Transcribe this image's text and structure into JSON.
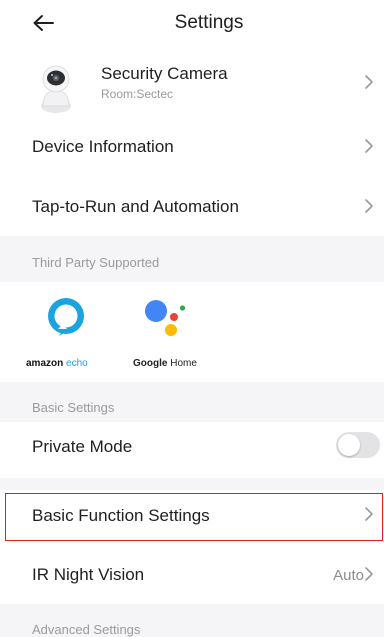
{
  "header": {
    "title": "Settings",
    "back_icon": "arrow-left-icon"
  },
  "device": {
    "name": "Security Camera",
    "room": "Room:Sectec",
    "icon": "camera-icon"
  },
  "rows": {
    "device_info": "Device Information",
    "tap_to_run": "Tap-to-Run and Automation",
    "private_mode": "Private Mode",
    "basic_function": "Basic Function Settings",
    "ir_night_vision": "IR Night Vision",
    "ir_night_vision_value": "Auto"
  },
  "sections": {
    "third_party": "Third Party Supported",
    "basic_settings": "Basic Settings",
    "advanced_settings": "Advanced Settings"
  },
  "vendors": {
    "amazon_label_a": "amazon",
    "amazon_label_b": " echo",
    "google_label_a": "Google",
    "google_label_b": " Home"
  },
  "toggles": {
    "private_mode_on": false
  },
  "colors": {
    "section_bg": "#f5f5f7",
    "highlight": "#e02020",
    "echo_blue": "#1ba5e0",
    "google_blue": "#4285f4",
    "google_red": "#ea4335",
    "google_yellow": "#fbbc05",
    "google_green": "#34a853"
  }
}
